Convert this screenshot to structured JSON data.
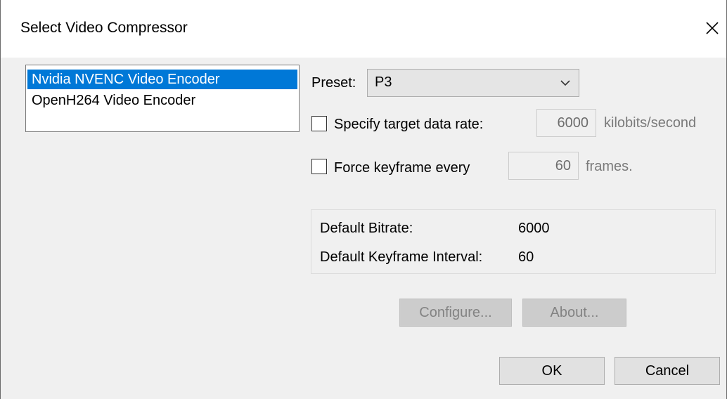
{
  "window": {
    "title": "Select Video Compressor"
  },
  "compressors": [
    {
      "label": "Nvidia NVENC Video Encoder",
      "selected": true
    },
    {
      "label": "OpenH264 Video Encoder",
      "selected": false
    }
  ],
  "preset": {
    "label": "Preset:",
    "value": "P3"
  },
  "data_rate": {
    "label": "Specify target data rate:",
    "value": "6000",
    "unit": "kilobits/second",
    "checked": false
  },
  "keyframe": {
    "label": "Force keyframe every",
    "value": "60",
    "unit": "frames.",
    "checked": false
  },
  "info": {
    "bitrate_label": "Default Bitrate:",
    "bitrate_value": "6000",
    "interval_label": "Default Keyframe Interval:",
    "interval_value": "60"
  },
  "buttons": {
    "configure": "Configure...",
    "about": "About...",
    "ok": "OK",
    "cancel": "Cancel"
  },
  "icons": {
    "close": "close-icon",
    "dropdown": "chevron-down-icon"
  },
  "colors": {
    "selection": "#0078d7",
    "dialog_bg": "#f0f0f0"
  }
}
